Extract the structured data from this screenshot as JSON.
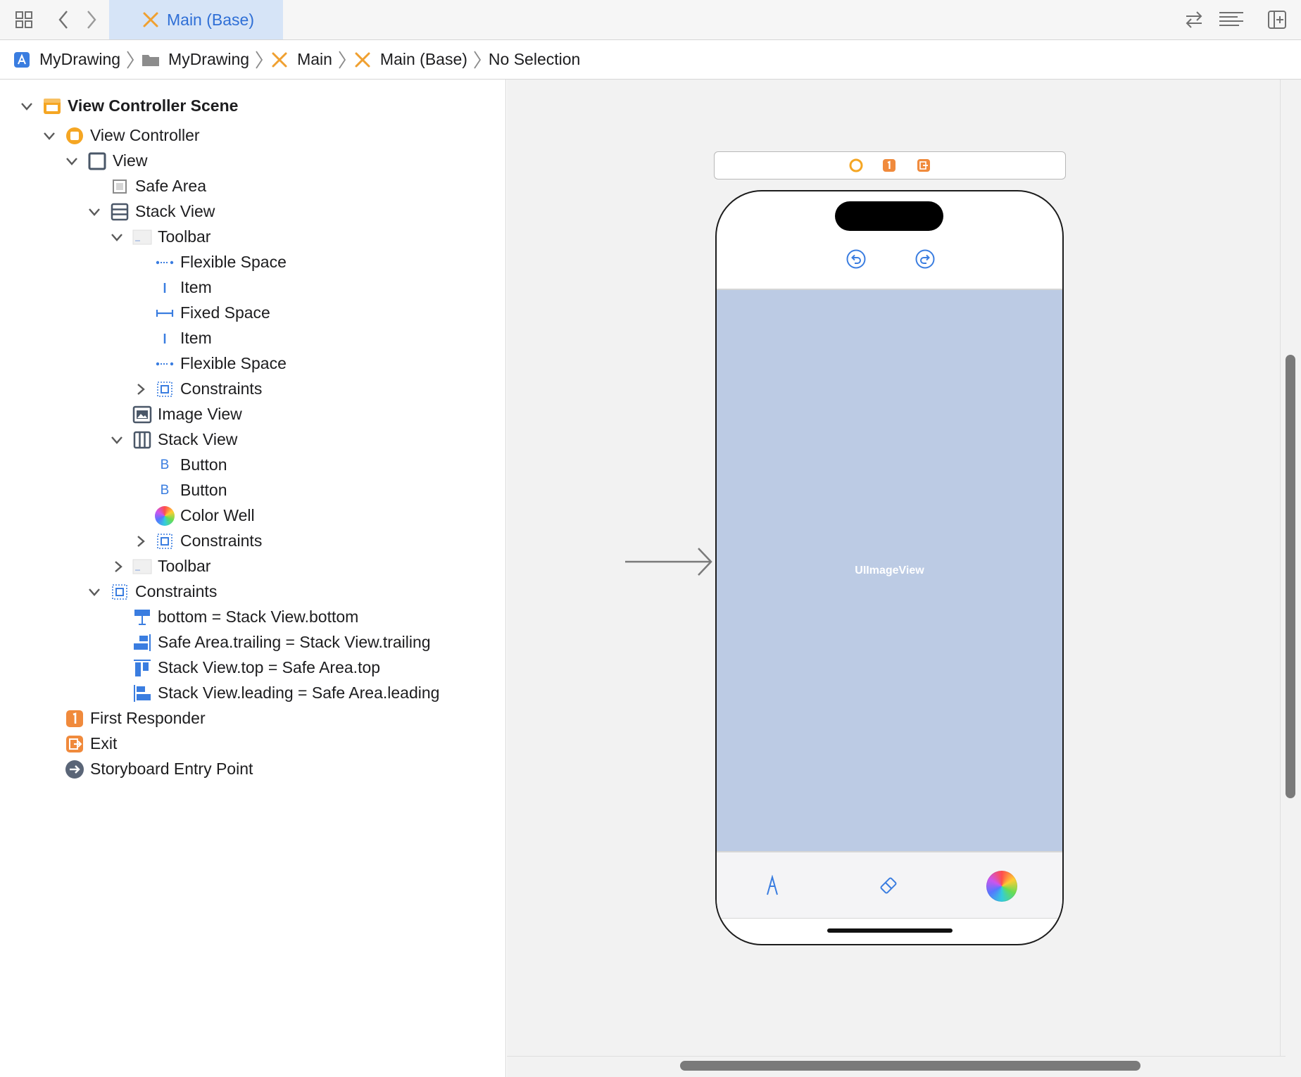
{
  "tabbar": {
    "active_tab": "Main (Base)"
  },
  "breadcrumb": [
    "MyDrawing",
    "MyDrawing",
    "Main",
    "Main (Base)",
    "No Selection"
  ],
  "outline": {
    "scene": "View Controller Scene",
    "view_controller": "View Controller",
    "view": "View",
    "safe_area": "Safe Area",
    "stack_view_outer": "Stack View",
    "toolbar_top": "Toolbar",
    "toolbar_items": [
      "Flexible Space",
      "Item",
      "Fixed Space",
      "Item",
      "Flexible Space"
    ],
    "toolbar_constraints": "Constraints",
    "image_view": "Image View",
    "stack_view_inner": "Stack View",
    "inner_items": [
      "Button",
      "Button",
      "Color Well"
    ],
    "inner_constraints": "Constraints",
    "toolbar_bottom": "Toolbar",
    "view_constraints": "Constraints",
    "constraint_list": [
      "bottom = Stack View.bottom",
      "Safe Area.trailing = Stack View.trailing",
      "Stack View.top = Safe Area.top",
      "Stack View.leading = Safe Area.leading"
    ],
    "first_responder": "First Responder",
    "exit": "Exit",
    "entry_point": "Storyboard Entry Point"
  },
  "canvas": {
    "image_view_label": "UIImageView"
  },
  "colors": {
    "accent": "#2f6fd6",
    "tab_active_bg": "#d6e4f7",
    "image_view_bg": "#bccbe4",
    "orange": "#f08a3c",
    "canvas_bg": "#f2f2f2"
  }
}
